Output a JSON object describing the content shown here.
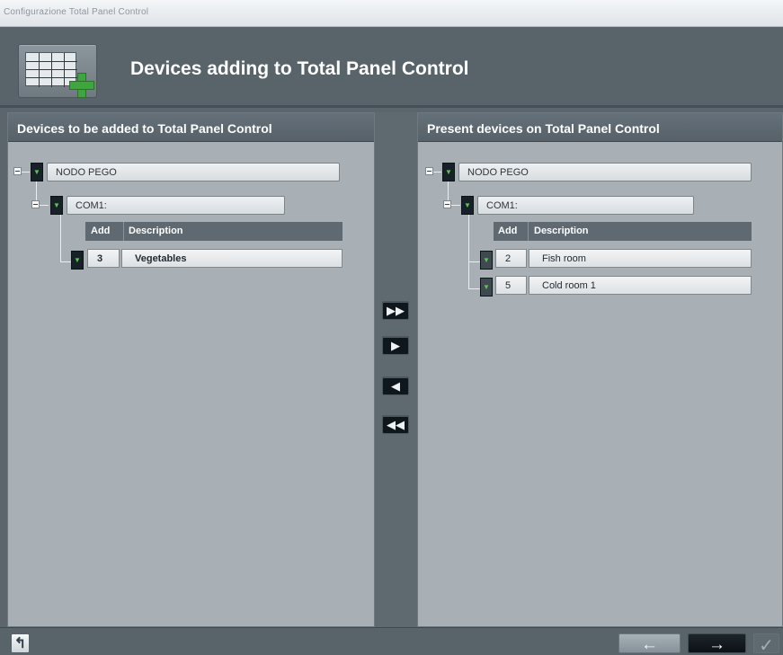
{
  "window": {
    "title": "Configurazione Total Panel Control"
  },
  "header": {
    "title": "Devices adding to Total Panel Control",
    "icon": "add-panel-icon"
  },
  "left_panel": {
    "title": "Devices to be added to Total Panel Control",
    "node_label": "NODO PEGO",
    "port_label": "COM1:",
    "table": {
      "columns": [
        "Add",
        "Description"
      ],
      "rows": [
        {
          "add": "3",
          "description": "Vegetables"
        }
      ]
    }
  },
  "right_panel": {
    "title": "Present devices on Total Panel Control",
    "node_label": "NODO PEGO",
    "port_label": "COM1:",
    "table": {
      "columns": [
        "Add",
        "Description"
      ],
      "rows": [
        {
          "add": "2",
          "description": "Fish room"
        },
        {
          "add": "5",
          "description": "Cold room 1"
        }
      ]
    }
  },
  "transfer_buttons": {
    "add_all": "▶▶",
    "add_one": "▶",
    "remove_one": "◀",
    "remove_all": "◀◀"
  },
  "footer": {
    "back_icon": "↰",
    "prev_label": "←",
    "next_label": "→",
    "confirm_label": "✓"
  },
  "colors": {
    "window_bg": "#5c656b",
    "panel_bg": "#a8b0b6",
    "accent_green": "#3fa53e"
  }
}
